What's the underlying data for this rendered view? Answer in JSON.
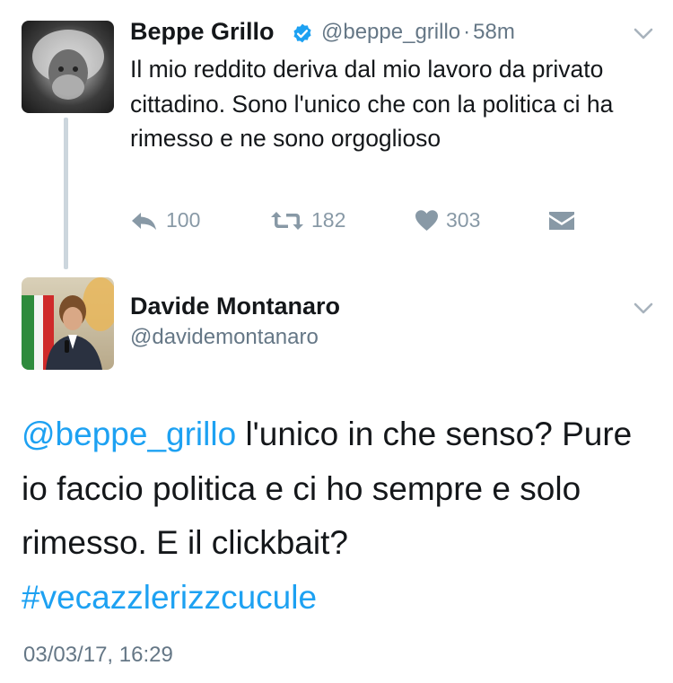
{
  "colors": {
    "link": "#1da1f2",
    "verified": "#1da1f2",
    "secondary_text": "#657786",
    "action_gray": "#8899a6"
  },
  "tweet1": {
    "name": "Beppe Grillo",
    "handle": "@beppe_grillo",
    "separator": "·",
    "time": "58m",
    "text": "Il mio reddito deriva dal mio lavoro da privato cittadino. Sono l'unico che con la politica ci ha rimesso e ne sono orgoglioso",
    "actions": {
      "reply_count": "100",
      "retweet_count": "182",
      "like_count": "303"
    },
    "icons": [
      "verified-icon",
      "chevron-down-icon",
      "reply-icon",
      "retweet-icon",
      "like-icon",
      "message-icon"
    ]
  },
  "tweet2": {
    "name": "Davide Montanaro",
    "handle": "@davidemontanaro",
    "mention": "@beppe_grillo",
    "text_main": " l'unico in che senso? Pure io faccio politica e ci ho sempre e solo rimesso. E il clickbait?",
    "hashtag": "#vecazzlerizzcucule",
    "timestamp": "03/03/17, 16:29",
    "icons": [
      "chevron-down-icon"
    ]
  }
}
